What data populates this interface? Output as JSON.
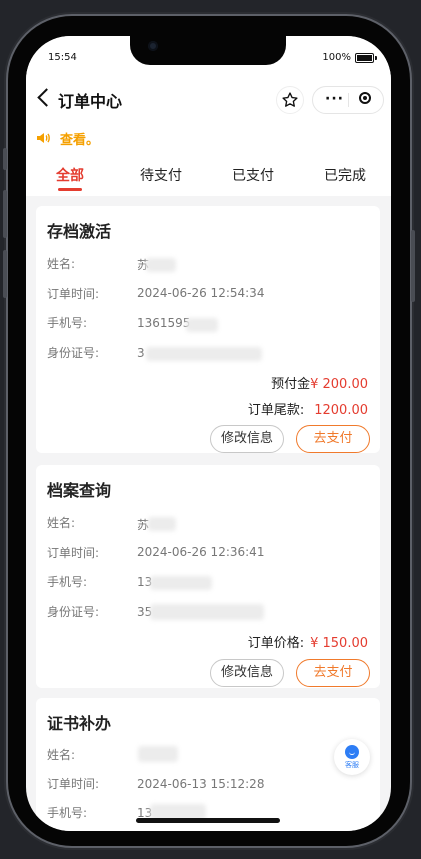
{
  "status_bar": {
    "time": "15:54",
    "battery": "100%"
  },
  "nav": {
    "title": "订单中心"
  },
  "notice": {
    "text": "查看。"
  },
  "tabs": [
    {
      "label": "全部",
      "active": true
    },
    {
      "label": "待支付"
    },
    {
      "label": "已支付"
    },
    {
      "label": "已完成"
    }
  ],
  "labels": {
    "name": "姓名:",
    "order_time": "订单时间:",
    "phone": "手机号:",
    "id_card": "身份证号:"
  },
  "orders": [
    {
      "title": "存档激活",
      "name": "苏",
      "order_time": "2024-06-26 12:54:34",
      "phone": "1361595",
      "id_card": "3",
      "prices": [
        {
          "label": "预付金",
          "value": "¥ 200.00"
        },
        {
          "label": "订单尾款:",
          "value": "1200.00"
        }
      ],
      "buttons": {
        "edit": "修改信息",
        "pay": "去支付"
      }
    },
    {
      "title": "档案查询",
      "name": "苏",
      "order_time": "2024-06-26 12:36:41",
      "phone": "13",
      "id_card": "35",
      "prices": [
        {
          "label": "订单价格:",
          "value": "¥ 150.00"
        }
      ],
      "buttons": {
        "edit": "修改信息",
        "pay": "去支付"
      }
    },
    {
      "title": "证书补办",
      "name": "",
      "order_time": "2024-06-13 15:12:28",
      "phone": "13",
      "id_card": ""
    }
  ],
  "service": {
    "label": "客服"
  },
  "colors": {
    "accent_red": "#e43c2f",
    "accent_orange": "#f07a2c",
    "notice_yellow": "#f5a000",
    "service_blue": "#2d7df5"
  }
}
